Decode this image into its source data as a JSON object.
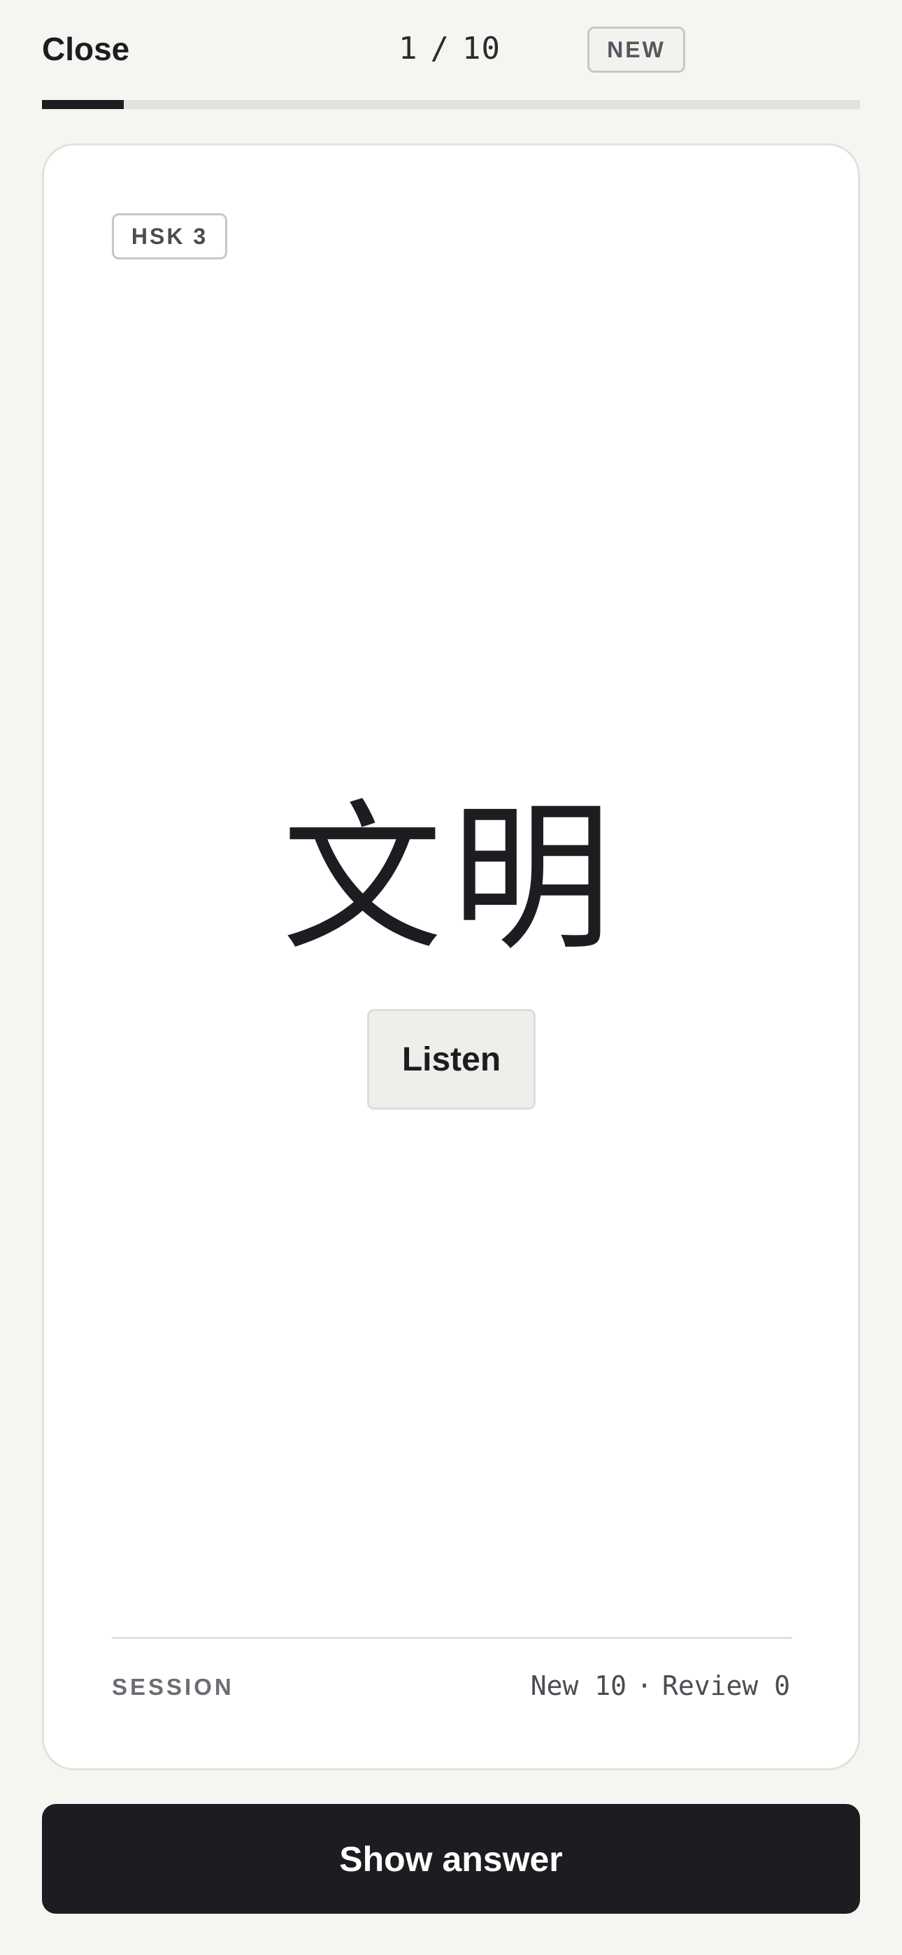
{
  "header": {
    "close_label": "Close",
    "counter": {
      "current": "1",
      "separator": "/",
      "total": "10"
    },
    "status_badge": "NEW"
  },
  "progress": {
    "fraction": 0.1
  },
  "card": {
    "level_badge": "HSK 3",
    "hanzi": "文明",
    "listen_label": "Listen",
    "session": {
      "label": "SESSION",
      "new_text": "New 10",
      "separator": "·",
      "review_text": "Review 0"
    }
  },
  "footer": {
    "show_answer_label": "Show answer"
  },
  "colors": {
    "background": "#f6f5f2",
    "card": "#ffffff",
    "primary_dark": "#1c1d20",
    "progress_track": "#e3e2de"
  }
}
